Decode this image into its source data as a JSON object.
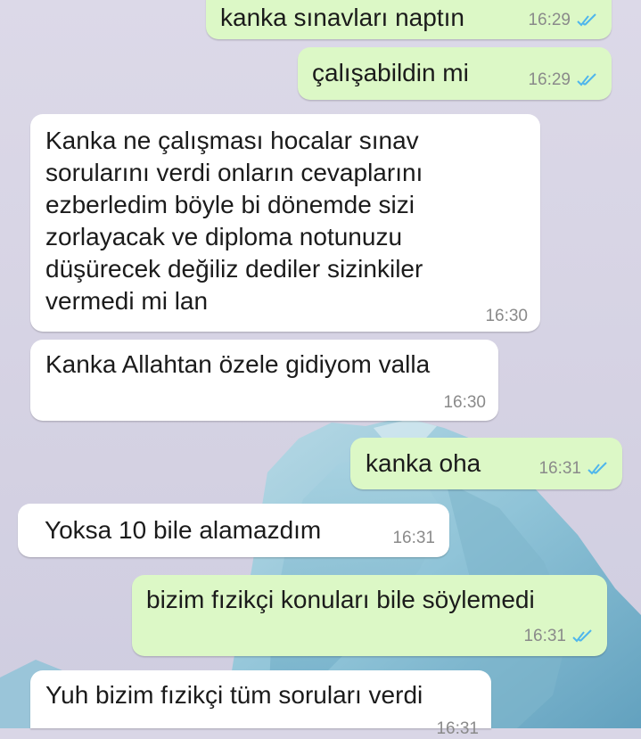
{
  "theme": {
    "outgoing_bubble": "#dcf8c6",
    "incoming_bubble": "#ffffff",
    "read_ticks": "#4fb6ec",
    "timestamp": "#8a8a8a"
  },
  "messages": [
    {
      "direction": "outgoing",
      "text": "kanka sınavları naptın",
      "time": "16:29",
      "status": "read-double-check-icon"
    },
    {
      "direction": "outgoing",
      "text": "çalışabildin mi",
      "time": "16:29",
      "status": "read-double-check-icon"
    },
    {
      "direction": "incoming",
      "text": "Kanka ne çalışması hocalar sınav\nsorularını verdi onların cevaplarını\nezberledim böyle bi dönemde sizi\nzorlayacak ve diploma notunuzu\ndüşürecek değiliz dediler sizinkiler\nvermedi mi lan",
      "time": "16:30"
    },
    {
      "direction": "incoming",
      "text": "Kanka Allahtan özele gidiyom valla",
      "time": "16:30"
    },
    {
      "direction": "outgoing",
      "text": "kanka oha",
      "time": "16:31",
      "status": "read-double-check-icon"
    },
    {
      "direction": "incoming",
      "text": "Yoksa 10 bile alamazdım",
      "time": "16:31"
    },
    {
      "direction": "outgoing",
      "text": "bizim fızikçi konuları bile söylemedi",
      "time": "16:31",
      "status": "read-double-check-icon"
    },
    {
      "direction": "incoming",
      "text": "Yuh bizim fızikçi tüm soruları verdi",
      "time": "16:31"
    }
  ]
}
